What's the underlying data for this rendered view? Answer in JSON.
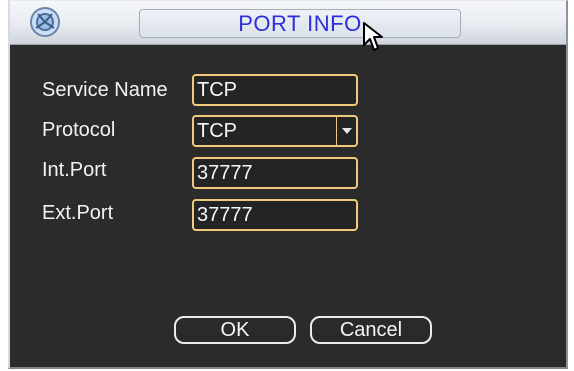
{
  "dialog": {
    "title": "PORT INFO",
    "icons": {
      "app": "app-logo-icon",
      "cursor": "mouse-pointer-icon"
    }
  },
  "form": {
    "service_name": {
      "label": "Service Name",
      "value": "TCP"
    },
    "protocol": {
      "label": "Protocol",
      "value": "TCP"
    },
    "int_port": {
      "label": "Int.Port",
      "value": "37777"
    },
    "ext_port": {
      "label": "Ext.Port",
      "value": "37777"
    }
  },
  "buttons": {
    "ok": "OK",
    "cancel": "Cancel"
  },
  "colors": {
    "title_text": "#2d2fd8",
    "field_border": "#f0c97a",
    "background": "#2b2b2b"
  }
}
